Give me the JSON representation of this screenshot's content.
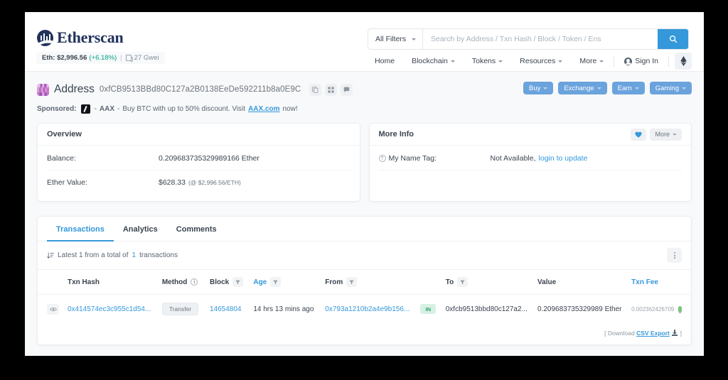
{
  "header": {
    "brand_name": "Etherscan",
    "eth_price_label": "Eth: $2,996.56",
    "eth_price_change": "(+6.18%)",
    "separator": "|",
    "gas_price": "27 Gwei"
  },
  "search": {
    "filter_label": "All Filters",
    "placeholder": "Search by Address / Txn Hash / Block / Token / Ens",
    "value": ""
  },
  "nav": {
    "items": [
      {
        "label": "Home",
        "caret": false
      },
      {
        "label": "Blockchain",
        "caret": true
      },
      {
        "label": "Tokens",
        "caret": true
      },
      {
        "label": "Resources",
        "caret": true
      },
      {
        "label": "More",
        "caret": true
      }
    ],
    "sign_in": "Sign In"
  },
  "address_bar": {
    "title": "Address",
    "hash": "0xfCB9513BBd80C127a2B0138EeDe592211b8a0E9C",
    "icons": [
      "copy-icon",
      "qr-code-icon",
      "message-icon"
    ],
    "buttons": [
      {
        "label": "Buy"
      },
      {
        "label": "Exchange"
      },
      {
        "label": "Earn"
      },
      {
        "label": "Gaming"
      }
    ]
  },
  "sponsored": {
    "label": "Sponsored:",
    "dash1": "-",
    "advertiser": "AAX",
    "dash2": "-",
    "text": "Buy BTC with up to 50% discount. Visit",
    "link": "AAX.com",
    "tail": "now!"
  },
  "overview": {
    "title": "Overview",
    "rows": [
      {
        "key": "Balance:",
        "value": "0.209683735329989166 Ether",
        "sub": ""
      },
      {
        "key": "Ether Value:",
        "value": "$628.33",
        "sub": "(@ $2,996.56/ETH)"
      }
    ]
  },
  "more_info": {
    "title": "More Info",
    "more_label": "More",
    "rows": [
      {
        "key": "My Name Tag:",
        "value": "Not Available,",
        "link": "login to update"
      }
    ]
  },
  "tabs": [
    {
      "label": "Transactions",
      "active": true
    },
    {
      "label": "Analytics",
      "active": false
    },
    {
      "label": "Comments",
      "active": false
    }
  ],
  "subbar": {
    "prefix": "Latest 1 from a total of",
    "count": "1",
    "suffix": "transactions"
  },
  "table": {
    "columns": [
      {
        "label": "Txn Hash",
        "filter": false,
        "info": false,
        "blue": false
      },
      {
        "label": "Method",
        "filter": false,
        "info": true,
        "blue": false
      },
      {
        "label": "Block",
        "filter": true,
        "info": false,
        "blue": false
      },
      {
        "label": "Age",
        "filter": true,
        "info": false,
        "blue": true
      },
      {
        "label": "From",
        "filter": true,
        "info": false,
        "blue": false
      },
      {
        "label": "",
        "filter": false,
        "info": false,
        "blue": false
      },
      {
        "label": "To",
        "filter": true,
        "info": false,
        "blue": false
      },
      {
        "label": "Value",
        "filter": false,
        "info": false,
        "blue": false
      },
      {
        "label": "Txn Fee",
        "filter": false,
        "info": false,
        "blue": true
      }
    ],
    "rows": [
      {
        "txn_hash": "0x414574ec3c955c1d54...",
        "method": "Transfer",
        "block": "14654804",
        "age": "14 hrs 13 mins ago",
        "from": "0x793a1210b2a4e9b156...",
        "direction": "IN",
        "to": "0xfcb9513bbd80c127a2...",
        "value": "0.209683735329989 Ether",
        "txn_fee": "0.002362426709"
      }
    ]
  },
  "footer": {
    "open_bracket": "[",
    "download": "Download",
    "csv_export": "CSV Export",
    "close_bracket": "]"
  },
  "colors": {
    "accent": "#3498db",
    "brand": "#21325b",
    "positive": "#00a186",
    "in_badge": "#2a9d6e"
  }
}
